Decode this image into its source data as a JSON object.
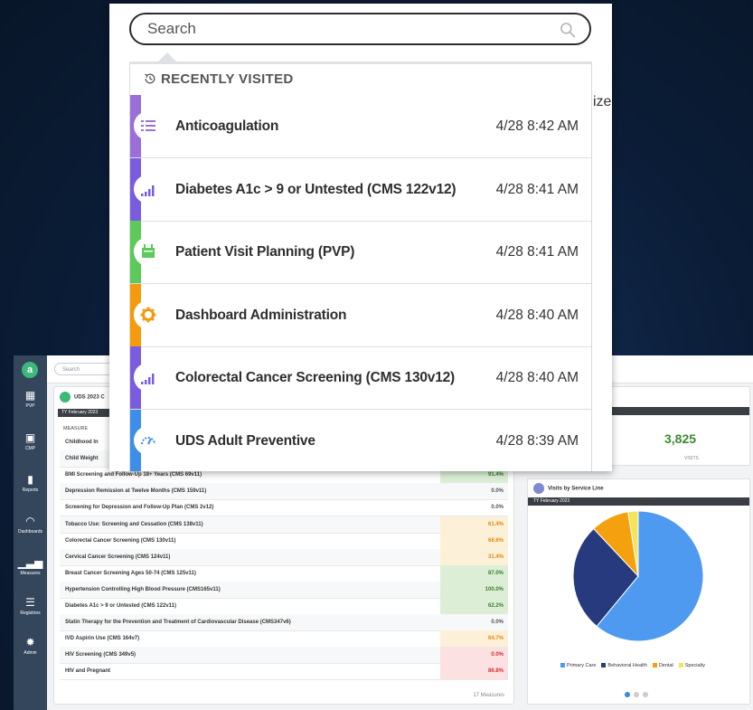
{
  "search": {
    "placeholder": "Search"
  },
  "behind_text": "ize",
  "recent": {
    "heading": "RECENTLY VISITED",
    "items": [
      {
        "title": "Anticoagulation",
        "time": "4/28 8:42 AM",
        "color": "#9b6fd8",
        "icon": "list-icon"
      },
      {
        "title": "Diabetes A1c > 9 or Untested (CMS 122v12)",
        "time": "4/28 8:41 AM",
        "color": "#7a5ce0",
        "icon": "bar-chart-icon"
      },
      {
        "title": "Patient Visit Planning (PVP)",
        "time": "4/28 8:41 AM",
        "color": "#5cc95a",
        "icon": "calendar-icon"
      },
      {
        "title": "Dashboard Administration",
        "time": "4/28 8:40 AM",
        "color": "#f59a0c",
        "icon": "gear-icon"
      },
      {
        "title": "Colorectal Cancer Screening (CMS 130v12)",
        "time": "4/28 8:40 AM",
        "color": "#7a5ce0",
        "icon": "bar-chart-icon"
      },
      {
        "title": "UDS Adult Preventive",
        "time": "4/28 8:39 AM",
        "color": "#3d8ee8",
        "icon": "gauge-icon"
      }
    ]
  },
  "app": {
    "logo": "a",
    "search_placeholder": "Search",
    "sidebar": [
      {
        "label": "PVP",
        "icon": "calendar-icon"
      },
      {
        "label": "CMP",
        "icon": "person-card-icon"
      },
      {
        "label": "Reports",
        "icon": "clipboard-icon"
      },
      {
        "label": "Dashboards",
        "icon": "gauge-icon"
      },
      {
        "label": "Measures",
        "icon": "bar-chart-icon"
      },
      {
        "label": "Registries",
        "icon": "list-icon"
      },
      {
        "label": "Admin",
        "icon": "gear-icon"
      }
    ],
    "left_card": {
      "title": "UDS 2023 C",
      "period": "TY February 2023",
      "column_header": "MEASURE",
      "rows": [
        {
          "name": "Childhood In",
          "value": "",
          "color": ""
        },
        {
          "name": "Child Weight",
          "value": "",
          "color": ""
        },
        {
          "name": "BMI Screening and Follow-Up 18+ Years (CMS 69v11)",
          "value": "91.4%",
          "color": "green"
        },
        {
          "name": "Depression Remission at Twelve Months (CMS 159v11)",
          "value": "0.0%",
          "color": "none"
        },
        {
          "name": "Screening for Depression and Follow-Up Plan (CMS 2v12)",
          "value": "0.0%",
          "color": "none"
        },
        {
          "name": "Tobacco Use: Screening and Cessation (CMS 138v11)",
          "value": "61.4%",
          "color": "orange"
        },
        {
          "name": "Colorectal Cancer Screening (CMS 130v11)",
          "value": "68.6%",
          "color": "orange"
        },
        {
          "name": "Cervical Cancer Screening (CMS 124v11)",
          "value": "31.4%",
          "color": "orange"
        },
        {
          "name": "Breast Cancer Screening Ages 50-74 (CMS 125v11)",
          "value": "87.0%",
          "color": "green"
        },
        {
          "name": "Hypertension Controlling High Blood Pressure (CMS165v11)",
          "value": "100.0%",
          "color": "green"
        },
        {
          "name": "Diabetes A1c > 9 or Untested (CMS 122v11)",
          "value": "62.2%",
          "color": "green"
        },
        {
          "name": "Statin Therapy for the Prevention and Treatment of Cardiovascular Disease (CMS347v6)",
          "value": "0.0%",
          "color": "none"
        },
        {
          "name": "IVD Aspirin Use (CMS 164v7)",
          "value": "64.7%",
          "color": "orange"
        },
        {
          "name": "HIV Screening (CMS 349v5)",
          "value": "0.0%",
          "color": "red"
        },
        {
          "name": "HIV and Pregnant",
          "value": "86.8%",
          "color": "red"
        }
      ],
      "footer": "17 Measures"
    },
    "visits": {
      "value": "3,825",
      "label": "VISITS"
    },
    "right_card": {
      "title": "Visits by Service Line",
      "period": "TY February 2023",
      "chart_data": {
        "type": "pie",
        "slices": [
          {
            "name": "Primary Care",
            "share": 0.61,
            "color": "#4e9af1"
          },
          {
            "name": "Behavioral Health",
            "share": 0.27,
            "color": "#283a7e"
          },
          {
            "name": "Dental",
            "share": 0.095,
            "color": "#f5a00f"
          },
          {
            "name": "Specialty",
            "share": 0.025,
            "color": "#f5e45a"
          }
        ]
      }
    }
  }
}
